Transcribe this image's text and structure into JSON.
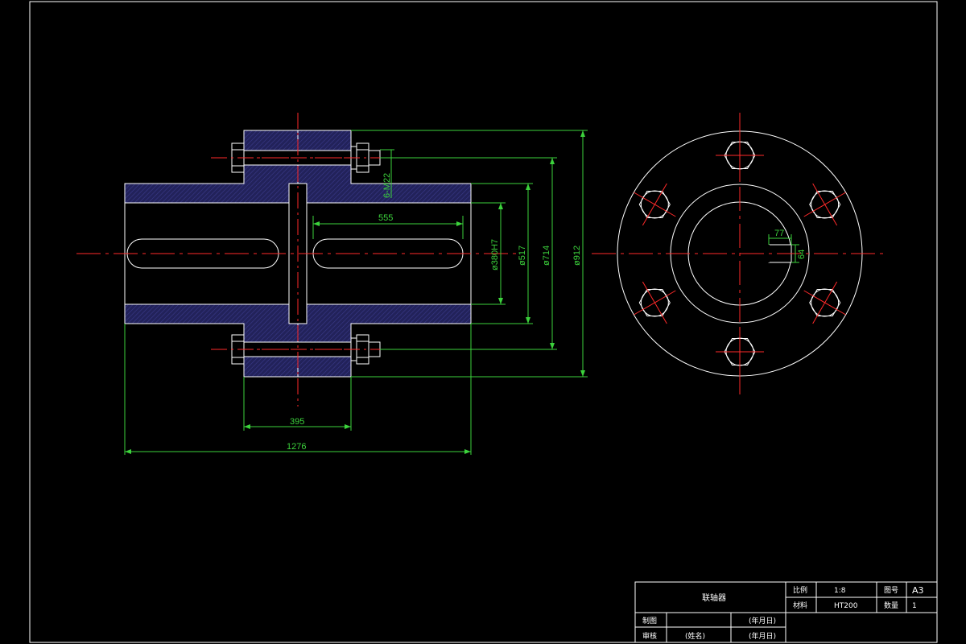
{
  "colors": {
    "background": "#000000",
    "outline": "#ffffff",
    "centerline": "#ff2a2a",
    "dimension": "#3cd23c",
    "hatch": "#2b2b6e"
  },
  "dimensions": {
    "bolt_spec": "6-M22",
    "slot_length": "555",
    "bore": "ø380H7",
    "d517": "ø517",
    "d714": "ø714",
    "d912": "ø912",
    "flange_width": "395",
    "overall_length": "1276",
    "keyway_width": "77",
    "keyway_depth": "64"
  },
  "title_block": {
    "part_name": "联轴器",
    "scale_label": "比例",
    "scale_value": "1:8",
    "drawing_no_label": "图号",
    "drawing_no_value": "A3",
    "material_label": "材料",
    "material_value": "HT200",
    "quantity_label": "数量",
    "quantity_value": "1",
    "drawn_label": "制图",
    "drawn_date": "(年月日)",
    "checked_label": "审核",
    "checked_name": "(姓名)",
    "checked_date": "(年月日)"
  }
}
